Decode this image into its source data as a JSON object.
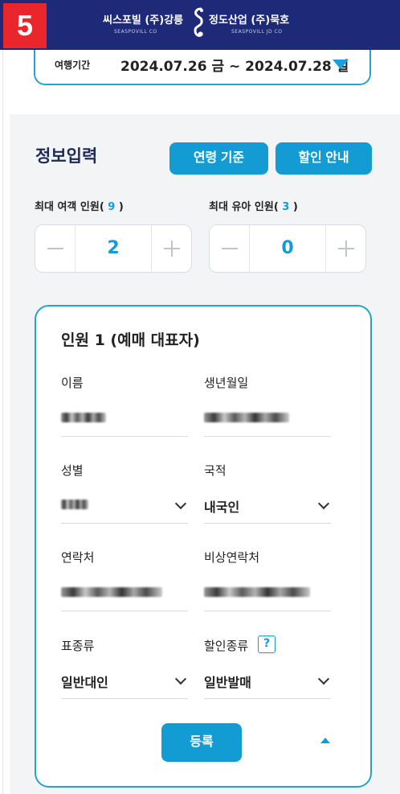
{
  "header": {
    "step_number": "5",
    "brand_left": "씨스포빌 (주)강릉",
    "brand_left_sub": "SEASPOVILL CO",
    "brand_right": "정도산업 (주)묵호",
    "brand_right_sub": "SEASPOVILL JD CO"
  },
  "period": {
    "label": "여행기간",
    "value": "2024.07.26 금 ~ 2024.07.28 일"
  },
  "info": {
    "title": "정보입력",
    "age_button": "연령 기준",
    "discount_button": "할인 안내",
    "adult_label": "최대 여객 인원",
    "adult_max": "9",
    "adult_count": "2",
    "child_label": "최대 유아 인원",
    "child_max": "3",
    "child_count": "0"
  },
  "passenger": {
    "title": "인원 1 (예매 대표자)",
    "name_label": "이름",
    "birth_label": "생년월일",
    "gender_label": "성별",
    "nationality_label": "국적",
    "nationality_value": "내국인",
    "phone_label": "연락처",
    "emergency_label": "비상연락처",
    "ticket_type_label": "표종류",
    "ticket_type_value": "일반대인",
    "discount_type_label": "할인종류",
    "discount_help": "?",
    "discount_type_value": "일반발매",
    "register_button": "등록"
  },
  "colors": {
    "header_bg": "#1e2a78",
    "badge": "#e8262b",
    "accent": "#139bd4",
    "border_accent": "#22a5c9"
  }
}
